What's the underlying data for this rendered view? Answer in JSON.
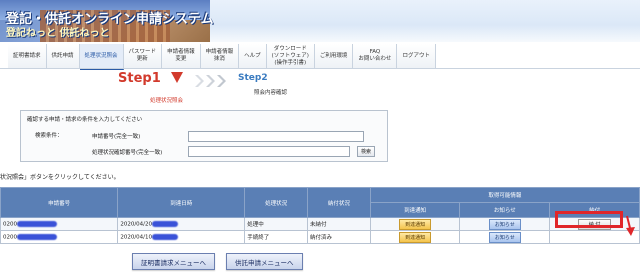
{
  "header": {
    "title_line1": "登記・供託オンライン申請システム",
    "title_line2": "登記ねっと 供託ねっと"
  },
  "nav": {
    "items": [
      {
        "label": "証明書請求",
        "active": false
      },
      {
        "label": "供託申請",
        "active": false
      },
      {
        "label": "処理状況照会",
        "active": true
      },
      {
        "label": "パスワード\n更新",
        "active": false
      },
      {
        "label": "申請者情報\n変更",
        "active": false
      },
      {
        "label": "申請者情報\n抹消",
        "active": false
      },
      {
        "label": "ヘルプ",
        "active": false
      },
      {
        "label": "ダウンロード\n(ソフトウェア)\n(操作手引書)",
        "active": false
      },
      {
        "label": "ご利用環境",
        "active": false
      },
      {
        "label": "FAQ\nお問い合わせ",
        "active": false
      },
      {
        "label": "ログアウト",
        "active": false
      }
    ]
  },
  "steps": {
    "step1_label": "Step1",
    "step1_sub": "処理状況照会",
    "step2_label": "Step2",
    "step2_sub": "照会内容確認"
  },
  "search": {
    "instruction": "確認する申請・請求の条件を入力してください",
    "conditions_label": "検索条件：",
    "field1_label": "申請番号(完全一致)",
    "field2_label": "処理状況確認番号(完全一致)",
    "search_button": "検索"
  },
  "hint": "状況照会」ボタンをクリックしてください。",
  "table": {
    "headers": {
      "app_no": "申請番号",
      "arrival": "到達日時",
      "status": "処理状況",
      "payment": "納付状況",
      "available": "取得可能情報",
      "sub_pickup": "到達通知",
      "sub_notice": "お知らせ",
      "sub_pay": "納付"
    },
    "rows": [
      {
        "app_no_prefix": "0200",
        "arrival_prefix": "2020/04/20",
        "status": "処理中",
        "payment": "未納付",
        "pickup_button": "到達通知",
        "notice_button": "お知らせ",
        "pay_button": "納 付"
      },
      {
        "app_no_prefix": "0200",
        "arrival_prefix": "2020/04/10",
        "status": "手続終了",
        "payment": "納付済み",
        "pickup_button": "到達通知",
        "notice_button": "お知らせ",
        "pay_button": ""
      }
    ]
  },
  "footer": {
    "cert_menu_button": "証明書請求メニューへ",
    "deposit_menu_button": "供託申請メニューへ"
  },
  "colors": {
    "accent_red": "#d23a2c",
    "step2_blue": "#3a7bc0",
    "table_header": "#5a7fb5",
    "highlight": "#e0262a"
  }
}
